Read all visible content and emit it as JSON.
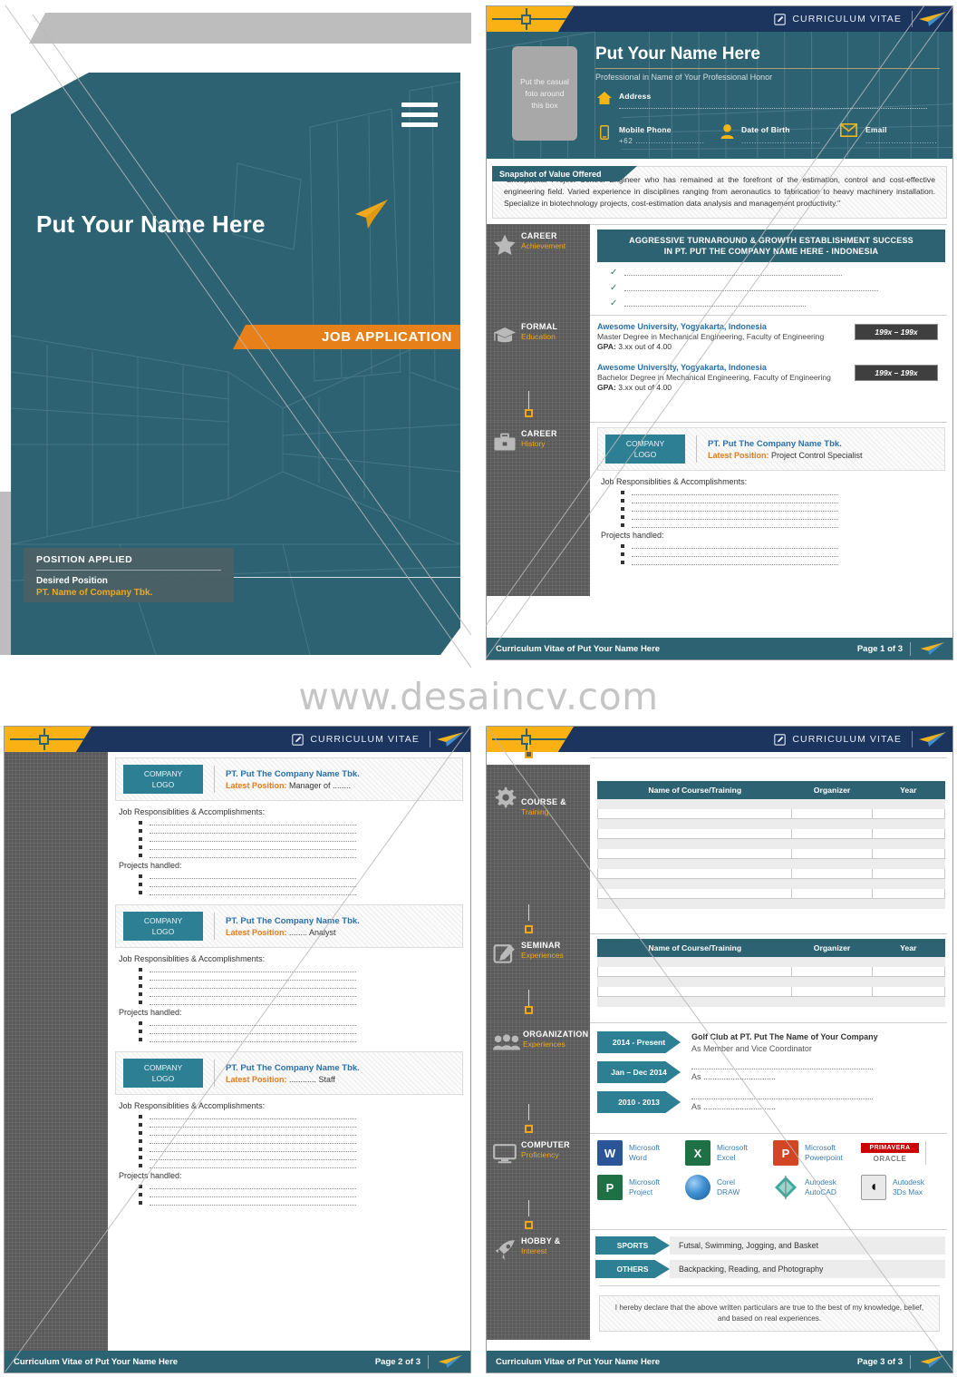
{
  "watermark": "www.desaincv.com",
  "cover": {
    "name": "Put Your Name Here",
    "job_band": "JOB APPLICATION",
    "position_heading": "POSITION APPLIED",
    "desired_position_label": "Desired Position",
    "company": "PT. Name of Company Tbk."
  },
  "header": {
    "label": "CURRICULUM VITAE",
    "edit_icon": "edit-document-icon",
    "plane_icon": "paper-plane-icon",
    "marker_icon": "crosshair-marker-icon"
  },
  "identity": {
    "photo_placeholder": [
      "Put the casual",
      "foto around",
      "this box"
    ],
    "name": "Put Your Name Here",
    "profession": "Professional in Name of Your Professional Honor",
    "fields": [
      {
        "icon": "home-icon",
        "label": "Address",
        "value": ""
      },
      {
        "icon": "mobile-icon",
        "label": "Mobile Phone",
        "value": "+62 ..........................."
      },
      {
        "icon": "person-icon",
        "label": "Date of Birth",
        "value": "..............................."
      },
      {
        "icon": "envelope-icon",
        "label": "Email",
        "value": "............................"
      }
    ]
  },
  "snapshot": {
    "ribbon": "Snapshot of Value Offered",
    "text": "\"Exceptional Project Control Engineer who has remained at the forefront of the estimation, control and cost-effective engineering field. Varied experience in disciplines ranging from aeronautics to fabrication to heavy machinery installation. Specialize in biotechnology projects, cost-estimation data analysis and management productivity.\""
  },
  "sections": {
    "career_achievement": {
      "line1": "CAREER",
      "line2": "Achievement",
      "icon": "star-icon"
    },
    "formal_education": {
      "line1": "FORMAL",
      "line2": "Education",
      "icon": "graduation-cap-icon"
    },
    "career_history": {
      "line1": "CAREER",
      "line2": "History",
      "icon": "briefcase-icon"
    },
    "course_training": {
      "line1": "COURSE &",
      "line2": "Training",
      "icon": "gear-icon"
    },
    "seminar": {
      "line1": "SEMINAR",
      "line2": "Experiences",
      "icon": "pencil-note-icon"
    },
    "organization": {
      "line1": "ORGANIZATION",
      "line2": "Experiences",
      "icon": "people-group-icon"
    },
    "computer": {
      "line1": "COMPUTER",
      "line2": "Proficiency",
      "icon": "monitor-icon"
    },
    "hobby": {
      "line1": "HOBBY &",
      "line2": "Interest",
      "icon": "rocket-icon"
    }
  },
  "achievement": {
    "banner_line1": "AGGRESSIVE TURNAROUND & GROWTH ESTABLISHMENT SUCCESS",
    "banner_line2": "IN PT. PUT THE COMPANY NAME HERE - INDONESIA",
    "bullets": 3
  },
  "education": [
    {
      "school": "Awesome University, Yogyakarta, Indonesia",
      "degree": "Master Degree in Mechanical Engineering, Faculty of Engineering",
      "gpa_label": "GPA:",
      "gpa_value": " 3.xx out of 4.00",
      "years": "199x – 199x"
    },
    {
      "school": "Awesome University, Yogyakarta, Indonesia",
      "degree": "Bachelor Degree in Mechanical Engineering, Faculty of Engineering",
      "gpa_label": "GPA:",
      "gpa_value": " 3.xx out of 4.00",
      "years": "199x – 199x"
    }
  ],
  "labels": {
    "company_logo_1": "COMPANY",
    "company_logo_2": "LOGO",
    "responsibilities": "Job Responsiblities & Accomplishments:",
    "projects": "Projects handled:",
    "latest_position": "Latest Position:"
  },
  "jobs": [
    {
      "company": "PT. Put The Company Name Tbk.",
      "position": " Project Control Specialist",
      "resp_count": 5,
      "proj_count": 3
    },
    {
      "company": "PT. Put The Company Name Tbk.",
      "position": " Manager of ........",
      "resp_count": 5,
      "proj_count": 3
    },
    {
      "company": "PT. Put The Company Name Tbk.",
      "position": " ........ Analyst",
      "resp_count": 5,
      "proj_count": 3
    },
    {
      "company": "PT. Put The Company Name Tbk.",
      "position": " ............ Staff",
      "resp_count": 7,
      "proj_count": 3
    }
  ],
  "tables": {
    "headers": [
      "Name of Course/Training",
      "Organizer",
      "Year"
    ],
    "course_rows": 11,
    "seminar_rows": 5
  },
  "organization": [
    {
      "period": "2014 - Present",
      "title": "Golf Club at PT. Put The Name of Your Company",
      "role": "As Member and Vice Coordinator",
      "blank": false
    },
    {
      "period": "Jan – Dec 2014",
      "title": "",
      "role": "As ................................",
      "blank": true
    },
    {
      "period": "2010 - 2013",
      "title": "",
      "role": "As ................................",
      "blank": true
    }
  ],
  "software": [
    {
      "name1": "Microsoft",
      "name2": "Word",
      "icon": "ms-word-icon",
      "glyph": "W",
      "color": "#2a5699"
    },
    {
      "name1": "Microsoft",
      "name2": "Excel",
      "icon": "ms-excel-icon",
      "glyph": "X",
      "color": "#1e7145"
    },
    {
      "name1": "Microsoft",
      "name2": "Powerpoint",
      "icon": "ms-powerpoint-icon",
      "glyph": "P",
      "color": "#d24625"
    },
    {
      "name1": "PRIMAVERA",
      "name2": "ORACLE",
      "icon": "primavera-oracle-icon",
      "glyph": "",
      "color": "#cc0000"
    },
    {
      "name1": "Microsoft",
      "name2": "Project",
      "icon": "ms-project-icon",
      "glyph": "P",
      "color": "#1e7145"
    },
    {
      "name1": "Corel",
      "name2": "DRAW",
      "icon": "coreldraw-icon",
      "glyph": "",
      "color": "#2a6fb5"
    },
    {
      "name1": "Autodesk",
      "name2": "AutoCAD",
      "icon": "autocad-icon",
      "glyph": "A",
      "color": "#3fa89b"
    },
    {
      "name1": "Autodesk",
      "name2": "3Ds Max",
      "icon": "3ds-max-icon",
      "glyph": "@",
      "color": "#e9e9e9"
    }
  ],
  "hobby": [
    {
      "tag": "SPORTS",
      "value": "Futsal, Swimming, Jogging, and Basket"
    },
    {
      "tag": "OTHERS",
      "value": "Backpacking, Reading, and Photography"
    }
  ],
  "declaration": "I hereby declare that the above written particulars are true to the best of my knowledge, belief, and based on real experiences.",
  "footer": {
    "text": "Curriculum Vitae of Put Your Name Here",
    "page1": "Page 1 of 3",
    "page2": "Page 2 of 3",
    "page3": "Page 3 of 3"
  }
}
